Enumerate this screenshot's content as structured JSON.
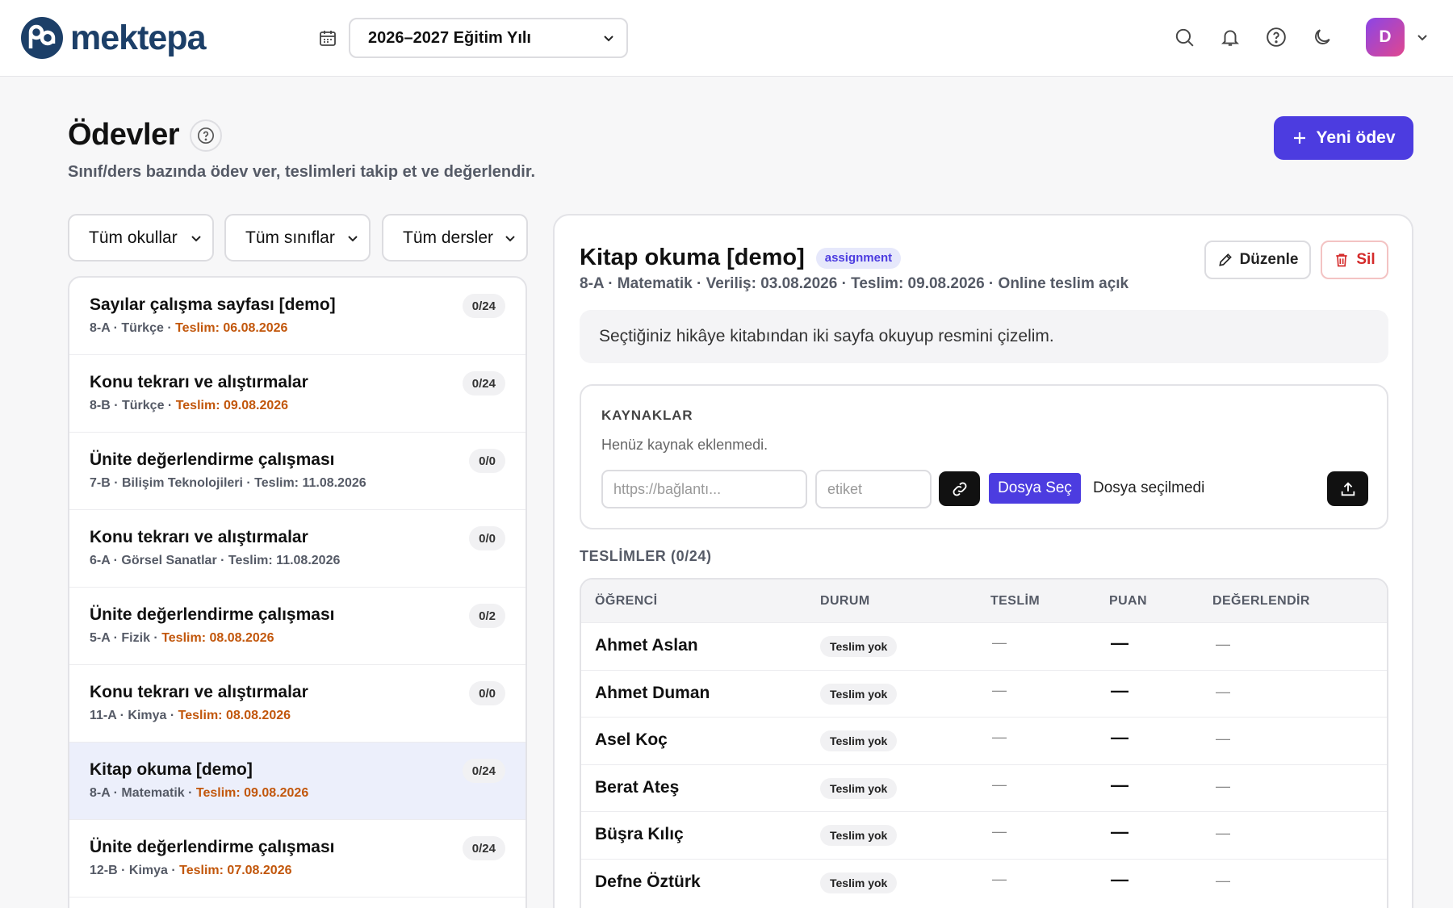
{
  "app": {
    "brand": "mektepa"
  },
  "topbar": {
    "year_select": "2026–2027 Eğitim Yılı",
    "avatar_initial": "D"
  },
  "header": {
    "title": "Ödevler",
    "subtitle": "Sınıf/ders bazında ödev ver, teslimleri takip et ve değerlendir.",
    "new_button": "Yeni ödev"
  },
  "filters": {
    "schools": "Tüm okullar",
    "classes": "Tüm sınıflar",
    "subjects": "Tüm dersler"
  },
  "list": {
    "items": [
      {
        "title": "Sayılar çalışma sayfası [demo]",
        "meta": "8-A · Türkçe · ",
        "due": "Teslim: 06.08.2026",
        "count": "0/24"
      },
      {
        "title": "Konu tekrarı ve alıştırmalar",
        "meta": "8-B · Türkçe · ",
        "due": "Teslim: 09.08.2026",
        "count": "0/24"
      },
      {
        "title": "Ünite değerlendirme çalışması",
        "meta": "7-B · Bilişim Teknolojileri · Teslim: 11.08.2026",
        "due": "",
        "count": "0/0"
      },
      {
        "title": "Konu tekrarı ve alıştırmalar",
        "meta": "6-A · Görsel Sanatlar · Teslim: 11.08.2026",
        "due": "",
        "count": "0/0"
      },
      {
        "title": "Ünite değerlendirme çalışması",
        "meta": "5-A · Fizik · ",
        "due": "Teslim: 08.08.2026",
        "count": "0/2"
      },
      {
        "title": "Konu tekrarı ve alıştırmalar",
        "meta": "11-A · Kimya · ",
        "due": "Teslim: 08.08.2026",
        "count": "0/0"
      },
      {
        "title": "Kitap okuma [demo]",
        "meta": "8-A · Matematik · ",
        "due": "Teslim: 09.08.2026",
        "count": "0/24"
      },
      {
        "title": "Ünite değerlendirme çalışması",
        "meta": "12-B · Kimya · ",
        "due": "Teslim: 07.08.2026",
        "count": "0/24"
      }
    ]
  },
  "detail": {
    "title": "Kitap okuma [demo]",
    "type_badge": "assignment",
    "meta": "8-A · Matematik · Veriliş: 03.08.2026 · Teslim: 09.08.2026 · Online teslim açık",
    "edit_label": "Düzenle",
    "delete_label": "Sil",
    "description": "Seçtiğiniz hikâye kitabından iki sayfa okuyup resmini çizelim.",
    "resources": {
      "heading": "KAYNAKLAR",
      "empty": "Henüz kaynak eklenmedi.",
      "url_placeholder": "https://bağlantı...",
      "tag_placeholder": "etiket",
      "file_button": "Dosya Seç",
      "file_status": "Dosya seçilmedi"
    },
    "submissions": {
      "heading": "TESLİMLER (0/24)",
      "columns": [
        "ÖĞRENCİ",
        "DURUM",
        "TESLİM",
        "PUAN",
        "DEĞERLENDİR"
      ],
      "rows": [
        {
          "student": "Ahmet Aslan",
          "status": "Teslim yok",
          "submitted": "—",
          "score": "—",
          "grade": "—"
        },
        {
          "student": "Ahmet Duman",
          "status": "Teslim yok",
          "submitted": "—",
          "score": "—",
          "grade": "—"
        },
        {
          "student": "Asel Koç",
          "status": "Teslim yok",
          "submitted": "—",
          "score": "—",
          "grade": "—"
        },
        {
          "student": "Berat Ateş",
          "status": "Teslim yok",
          "submitted": "—",
          "score": "—",
          "grade": "—"
        },
        {
          "student": "Büşra Kılıç",
          "status": "Teslim yok",
          "submitted": "—",
          "score": "—",
          "grade": "—"
        },
        {
          "student": "Defne Öztürk",
          "status": "Teslim yok",
          "submitted": "—",
          "score": "—",
          "grade": "—"
        }
      ]
    }
  },
  "colors": {
    "accent": "#4c3ce0",
    "due": "#c2570c",
    "danger": "#d42a2a",
    "brand": "#1c3f68"
  }
}
